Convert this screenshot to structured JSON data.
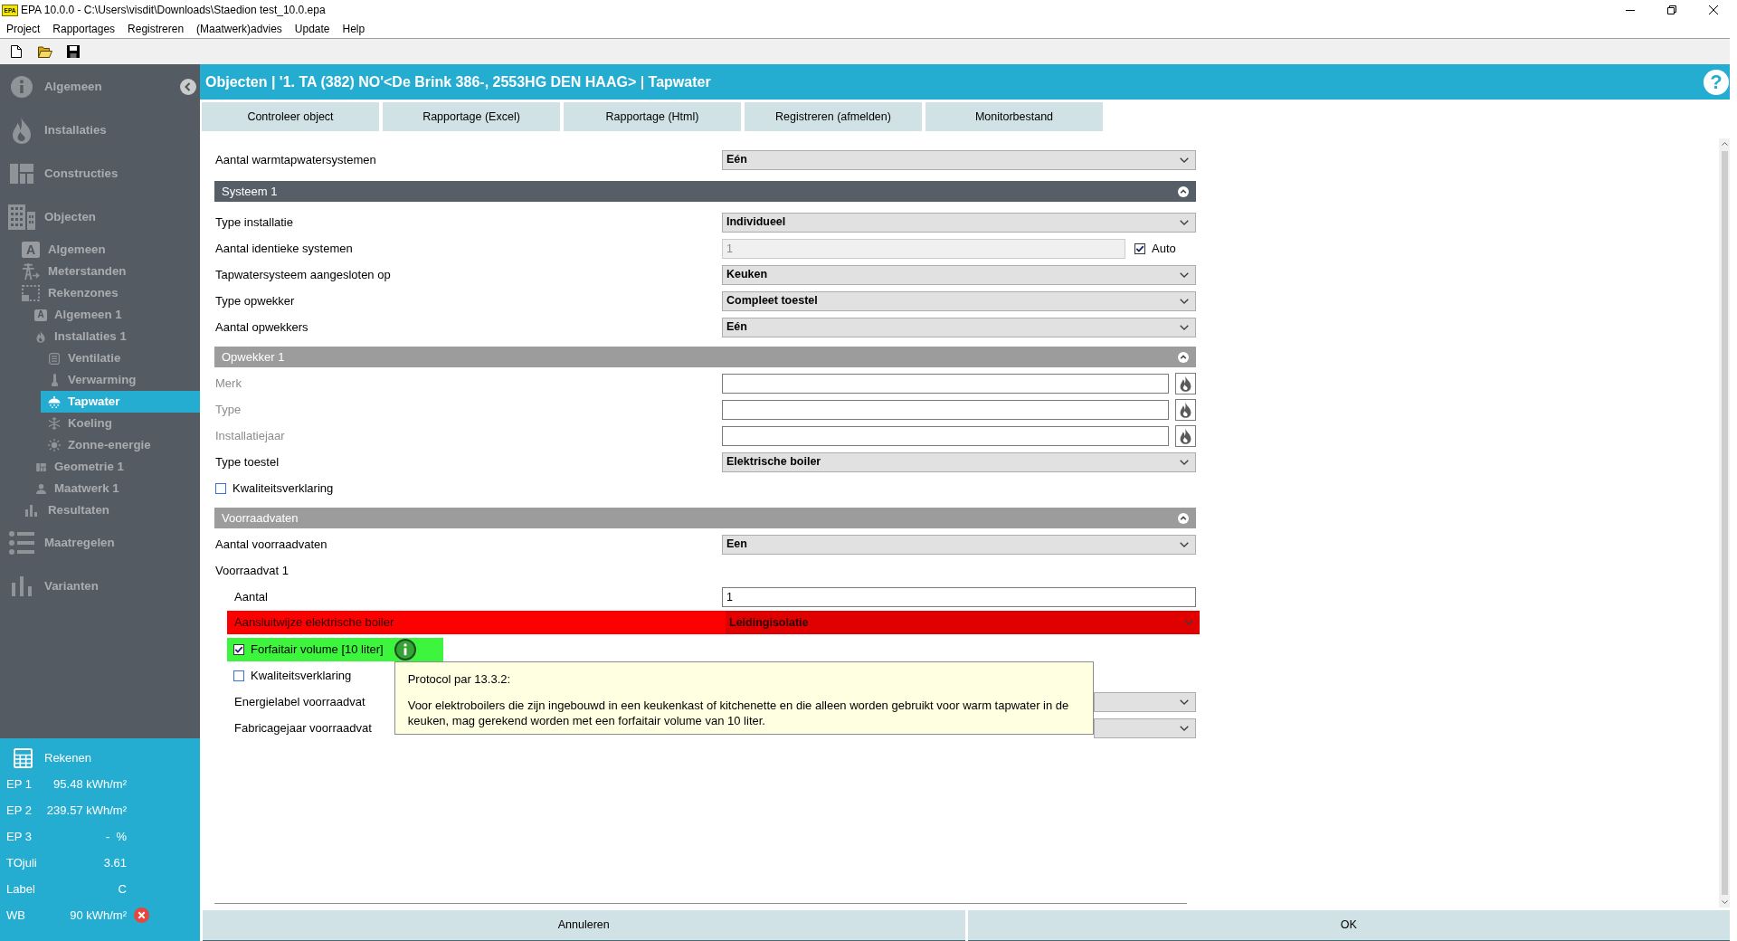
{
  "window": {
    "logo": "EPA",
    "title": "EPA 10.0.0 - C:\\Users\\visdit\\Downloads\\Staedion test_10.0.epa"
  },
  "menu": [
    "Project",
    "Rapportages",
    "Registreren",
    "(Maatwerk)advies",
    "Update",
    "Help"
  ],
  "sidebar": {
    "items": [
      {
        "label": "Algemeen",
        "selected": false
      },
      {
        "label": "Installaties",
        "selected": false
      },
      {
        "label": "Constructies",
        "selected": false
      },
      {
        "label": "Objecten",
        "selected": false,
        "children": [
          {
            "label": "Algemeen",
            "icon_letter": "A",
            "selected": false
          },
          {
            "label": "Meterstanden",
            "selected": false
          },
          {
            "label": "Rekenzones",
            "selected": false,
            "children": [
              {
                "label": "Algemeen 1",
                "icon_letter": "A",
                "selected": false
              },
              {
                "label": "Installaties 1",
                "selected": false,
                "children": [
                  {
                    "label": "Ventilatie",
                    "selected": false
                  },
                  {
                    "label": "Verwarming",
                    "selected": false
                  },
                  {
                    "label": "Tapwater",
                    "selected": true
                  },
                  {
                    "label": "Koeling",
                    "selected": false
                  },
                  {
                    "label": "Zonne-energie",
                    "selected": false
                  }
                ]
              },
              {
                "label": "Geometrie 1",
                "selected": false
              },
              {
                "label": "Maatwerk 1",
                "selected": false
              }
            ]
          },
          {
            "label": "Resultaten",
            "selected": false
          }
        ]
      },
      {
        "label": "Maatregelen",
        "selected": false
      },
      {
        "label": "Varianten",
        "selected": false
      }
    ],
    "calculate": {
      "label": "Rekenen"
    },
    "results": [
      {
        "label": "EP 1",
        "value": "95.48 kWh/m²",
        "error": false
      },
      {
        "label": "EP 2",
        "value": "239.57 kWh/m²",
        "error": false
      },
      {
        "label": "EP 3",
        "value": "-  %",
        "error": false
      },
      {
        "label": "TOjuli",
        "value": "3.61",
        "error": false
      },
      {
        "label": "Label",
        "value": "C",
        "error": false
      },
      {
        "label": "WB",
        "value": "90 kWh/m²",
        "error": true
      }
    ]
  },
  "header": {
    "title": "Objecten | '1. TA (382) NO'<De Brink 386-, 2553HG DEN HAAG> | Tapwater",
    "help": "?"
  },
  "actions": [
    "Controleer object",
    "Rapportage (Excel)",
    "Rapportage (Html)",
    "Registreren (afmelden)",
    "Monitorbestand"
  ],
  "form": [
    {
      "kind": "select",
      "label": "Aantal warmtapwatersystemen",
      "value": "Eén"
    },
    {
      "kind": "section",
      "title": "Systeem 1",
      "expanded": true,
      "children": [
        {
          "kind": "select",
          "label": "Type installatie",
          "value": "Individueel"
        },
        {
          "kind": "input",
          "label": "Aantal identieke systemen",
          "value": "1",
          "disabled": true,
          "option": {
            "label": "Auto",
            "checked": true
          }
        },
        {
          "kind": "select",
          "label": "Tapwatersysteem aangesloten op",
          "value": "Keuken"
        },
        {
          "kind": "select",
          "label": "Type opwekker",
          "value": "Compleet toestel"
        },
        {
          "kind": "select",
          "label": "Aantal opwekkers",
          "value": "Eén"
        },
        {
          "kind": "section",
          "title": "Opwekker 1",
          "expanded": true,
          "children": [
            {
              "kind": "lookup",
              "label": "Merk",
              "greyed": true
            },
            {
              "kind": "lookup",
              "label": "Type",
              "greyed": true
            },
            {
              "kind": "lookup",
              "label": "Installatiejaar",
              "greyed": true
            },
            {
              "kind": "select",
              "label": "Type toestel",
              "value": "Elektrische boiler"
            },
            {
              "kind": "checkbox",
              "label": "Kwaliteitsverklaring",
              "checked": false
            }
          ]
        },
        {
          "kind": "section",
          "title": "Voorraadvaten",
          "expanded": true,
          "children": [
            {
              "kind": "select",
              "label": "Aantal voorraadvaten",
              "value": "Een"
            },
            {
              "kind": "group",
              "label": "Voorraadvat 1",
              "children": [
                {
                  "kind": "input",
                  "label": "Aantal",
                  "value": "1",
                  "disabled": false
                },
                {
                  "kind": "select",
                  "label": "Aansluitwijze elektrische boiler",
                  "value": "Leidingisolatie",
                  "color": "#ff0000"
                },
                {
                  "kind": "checkbox",
                  "label": "Forfaitair volume [10 liter]",
                  "checked": true,
                  "color": "#3ef53e",
                  "tooltip": {
                    "title": "Protocol par 13.3.2:",
                    "text": "Voor elektroboilers die zijn ingebouwd in een keukenkast of kitchenette en die alleen worden gebruikt voor warm tapwater in de keuken, mag gerekend worden met een forfaitair volume van 10 liter."
                  }
                },
                {
                  "kind": "checkbox",
                  "label": "Kwaliteitsverklaring",
                  "checked": false
                },
                {
                  "kind": "select",
                  "label": "Energielabel voorraadvat"
                },
                {
                  "kind": "select",
                  "label": "Fabricagejaar voorraadvat"
                }
              ]
            }
          ]
        }
      ]
    }
  ],
  "footer": [
    "Annuleren",
    "OK"
  ]
}
